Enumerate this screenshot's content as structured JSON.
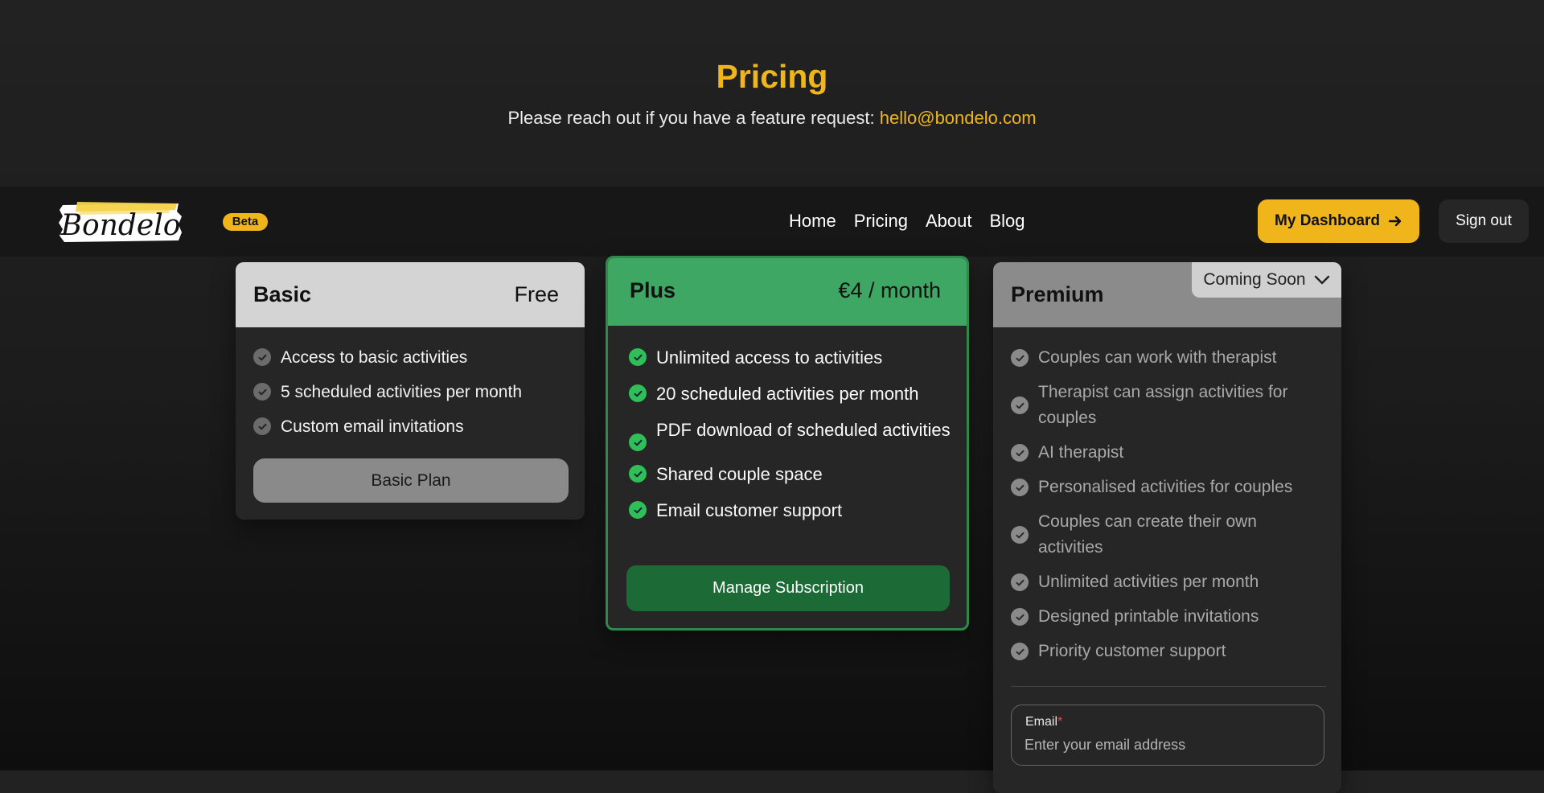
{
  "hero": {
    "title": "Pricing",
    "subtitle": "Please reach out if you have a feature request: ",
    "email": "hello@bondelo.com"
  },
  "nav": {
    "logo_text": "Bondelo",
    "beta_label": "Beta",
    "links": [
      "Home",
      "Pricing",
      "About",
      "Blog"
    ],
    "dashboard_label": "My Dashboard",
    "signout_label": "Sign out"
  },
  "plans": {
    "basic": {
      "name": "Basic",
      "price": "Free",
      "features": [
        "Access to basic activities",
        "5 scheduled activities per month",
        "Custom email invitations"
      ],
      "button": "Basic Plan"
    },
    "plus": {
      "name": "Plus",
      "price": "€4 / month",
      "features": [
        "Unlimited access to activities",
        "20 scheduled activities per month",
        "PDF download of scheduled activities",
        "Shared couple space",
        "Email customer support"
      ],
      "button": "Manage Subscription"
    },
    "premium": {
      "name": "Premium",
      "badge": "Coming Soon",
      "features": [
        "Couples can work with therapist",
        "Therapist can assign activities for couples",
        "AI therapist",
        "Personalised activities for couples",
        "Couples can create their own activities",
        "Unlimited activities per month",
        "Designed printable invitations",
        "Priority customer support"
      ],
      "email_label": "Email",
      "email_required_mark": "*",
      "email_placeholder": "Enter your email address"
    }
  },
  "colors": {
    "accent": "#f0b51a",
    "plus_green": "#3ea763",
    "check_green": "#2fbe58"
  }
}
